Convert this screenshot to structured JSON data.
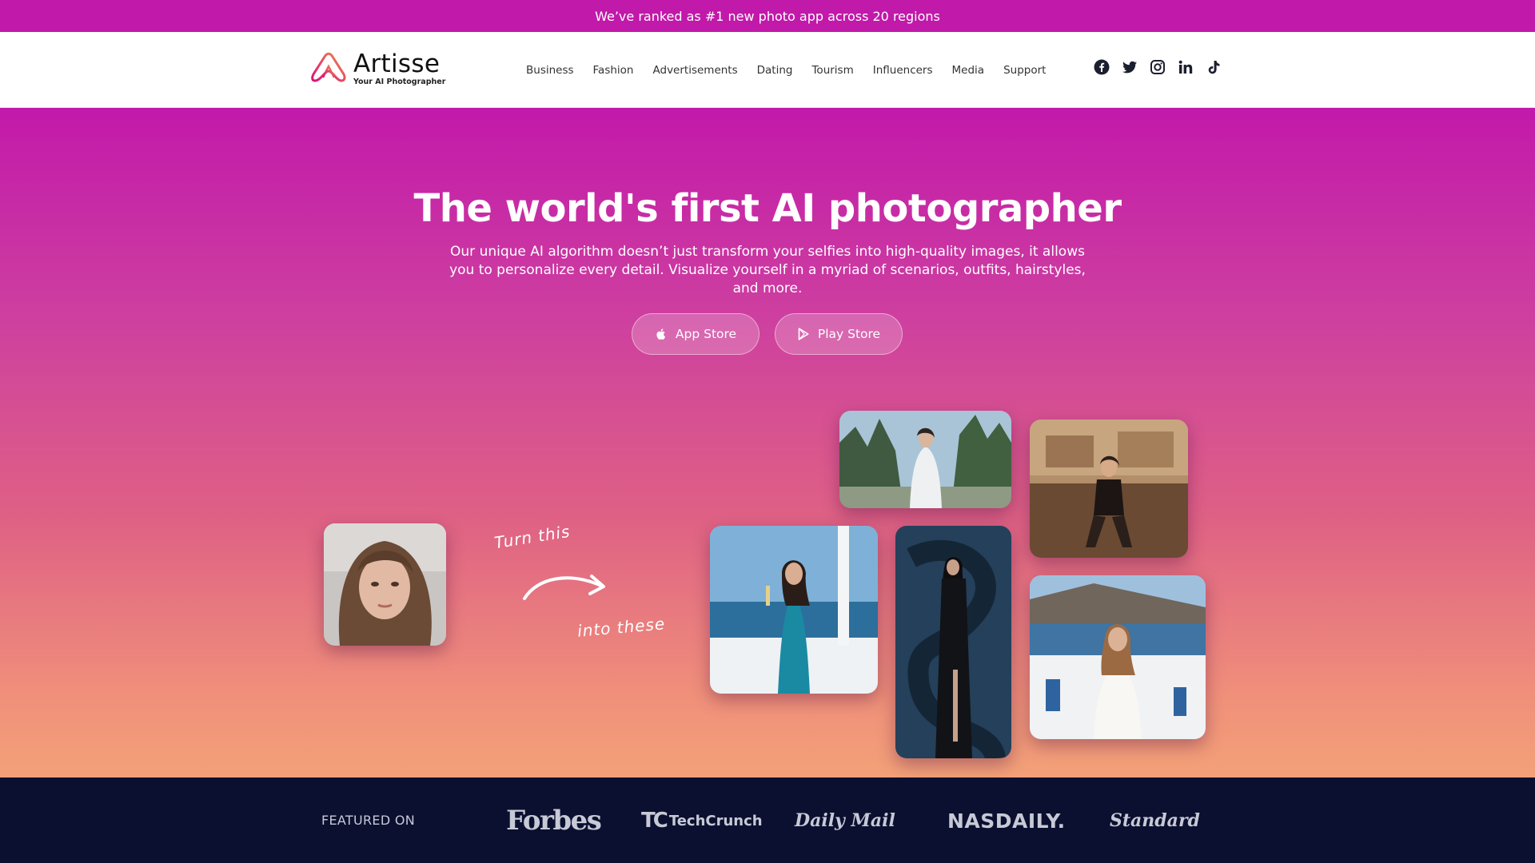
{
  "announcement": "We’ve ranked as #1 new photo app across 20 regions",
  "header": {
    "logo_name": "Artisse",
    "logo_tagline": "Your AI Photographer",
    "nav": [
      "Business",
      "Fashion",
      "Advertisements",
      "Dating",
      "Tourism",
      "Influencers",
      "Media",
      "Support"
    ],
    "social_icons": [
      "facebook-icon",
      "twitter-icon",
      "instagram-icon",
      "linkedin-icon",
      "tiktok-icon"
    ]
  },
  "hero": {
    "title": "The world's first AI photographer",
    "subtitle": "Our unique AI algorithm doesn’t just transform your selfies into high-quality images, it allows you to personalize every detail. Visualize yourself in a myriad of scenarios, outfits, hairstyles, and more.",
    "app_store_label": "App Store",
    "play_store_label": "Play Store",
    "turn_this": "Turn this",
    "into_these": "into these"
  },
  "featured": {
    "label": "FEATURED ON",
    "logos": [
      "Forbes",
      "TechCrunch",
      "Daily Mail",
      "NASDAILY.",
      "Standard"
    ],
    "techcrunch_mark": "TC"
  },
  "colors": {
    "brand_magenta": "#c119aa",
    "gradient_bottom": "#f3a178",
    "footer_navy": "#0b1030"
  }
}
